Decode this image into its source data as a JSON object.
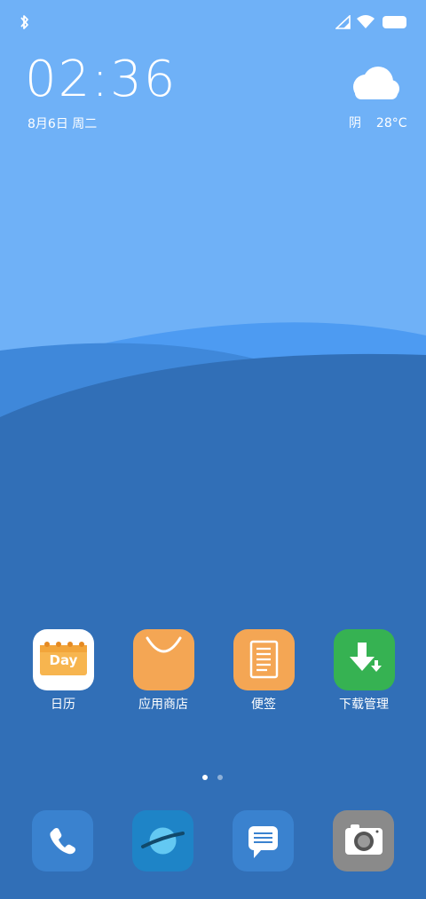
{
  "colors": {
    "sky": "#6fb1f7",
    "wave_light": "#4d9bf2",
    "wave_mid": "#3f88da",
    "wave_deep": "#316fb7",
    "calendar_bg": "#ffffff",
    "calendar_accent": "#f7b54f",
    "store_bg": "#f4a654",
    "notes_bg": "#f4a654",
    "download_bg": "#36b252",
    "dock_phone_bg": "#3a82cf",
    "dock_browser_bg": "#1e84c7",
    "dock_message_bg": "#3a82cf",
    "dock_camera_bg": "#8a8a8a"
  },
  "status_bar": {
    "left_icons": [
      "bluetooth-icon"
    ],
    "right_icons": [
      "signal-icon",
      "wifi-icon",
      "battery-icon"
    ]
  },
  "lock_widget": {
    "time": "02:36",
    "date": "8月6日 周二",
    "weather_condition": "阴",
    "temperature": "28°C",
    "weather_icon": "cloud-icon"
  },
  "apps": [
    {
      "name": "calendar",
      "label": "日历",
      "icon": "calendar-icon",
      "icon_text": "Day"
    },
    {
      "name": "app-store",
      "label": "应用商店",
      "icon": "shopping-bag-icon"
    },
    {
      "name": "notes",
      "label": "便签",
      "icon": "note-icon"
    },
    {
      "name": "download-manager",
      "label": "下载管理",
      "icon": "download-icon"
    }
  ],
  "page_indicator": {
    "pages": 2,
    "current": 1
  },
  "dock": [
    {
      "name": "phone",
      "icon": "phone-icon"
    },
    {
      "name": "browser",
      "icon": "planet-icon"
    },
    {
      "name": "messages",
      "icon": "message-icon"
    },
    {
      "name": "camera",
      "icon": "camera-icon"
    }
  ]
}
